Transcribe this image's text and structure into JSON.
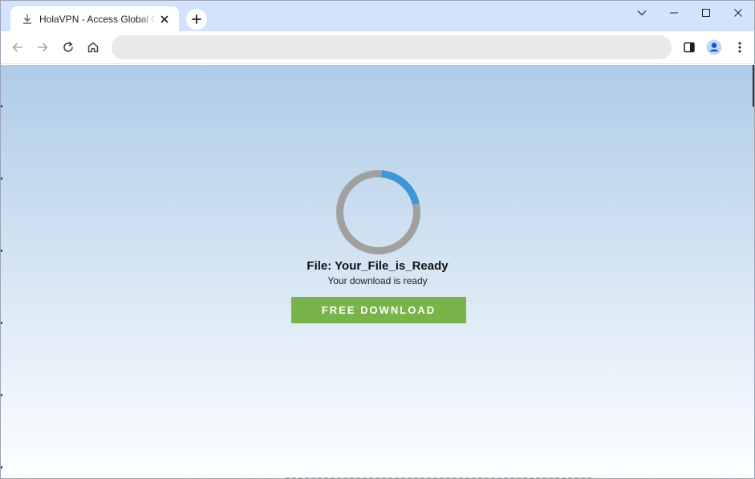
{
  "browser": {
    "tab": {
      "title": "HolaVPN - Access Global Content",
      "favicon": "download-icon"
    },
    "toolbar": {
      "back": "back-arrow-icon",
      "forward": "forward-arrow-icon",
      "reload": "reload-icon",
      "home": "home-icon",
      "address": "",
      "side_panel": "side-panel-icon",
      "profile": "profile-icon",
      "menu": "kebab-menu-icon"
    },
    "colors": {
      "tabstrip": "#d3e3fd",
      "profile": "#0b57d0"
    }
  },
  "page": {
    "file_title": "File: Your_File_is_Ready",
    "file_status": "Your download is ready",
    "download_label": "FREE DOWNLOAD",
    "progress_fraction": 0.2,
    "colors": {
      "spinner_track": "#a0a0a0",
      "spinner_arc": "#3d96d8",
      "button": "#79b34a"
    }
  }
}
